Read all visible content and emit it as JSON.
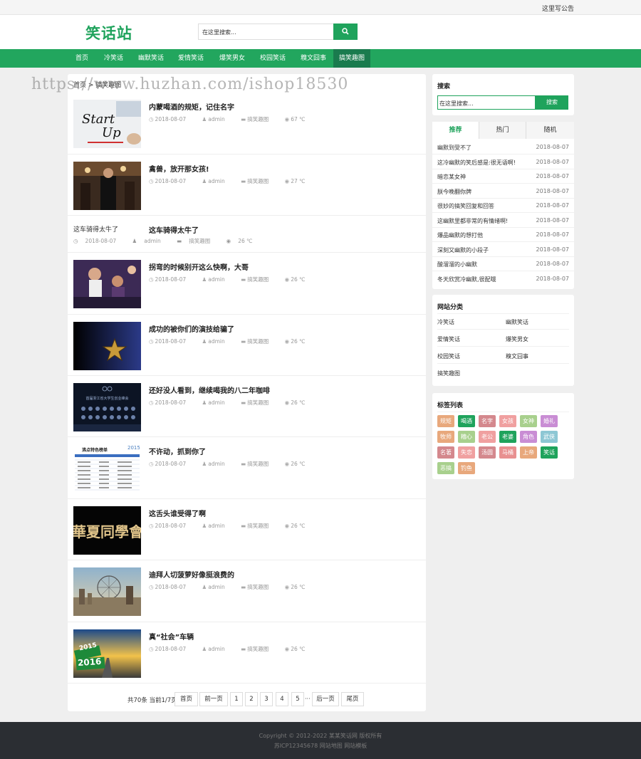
{
  "topbar": {
    "notice": "这里写公告"
  },
  "header": {
    "logo": "笑话站",
    "search_placeholder": "在这里搜索...",
    "search_icon": "search-icon"
  },
  "nav": [
    "首页",
    "冷笑话",
    "幽默笑话",
    "爱情笑话",
    "爆笑男女",
    "校园笑话",
    "糗文囧事",
    "搞笑趣图"
  ],
  "watermark": "https://www.huzhan.com/ishop18530",
  "breadcrumb": "首页 > 搞笑趣图",
  "articles": [
    {
      "title": "内蒙喝酒的规矩，记住名字",
      "date": "2018-08-07",
      "author": "admin",
      "category": "搞笑趣图",
      "views": "67 ℃",
      "thumb": "start-up"
    },
    {
      "title": "禽兽，放开那女孩!",
      "date": "2018-08-07",
      "author": "admin",
      "category": "搞笑趣图",
      "views": "27 ℃",
      "thumb": "man"
    },
    {
      "title": "这车骑得太牛了",
      "date": "2018-08-07",
      "author": "admin",
      "category": "搞笑趣图",
      "views": "26 ℃",
      "alt": "这车骑得太牛了"
    },
    {
      "title": "拐弯的时候别开这么快啊，大哥",
      "date": "2018-08-07",
      "author": "admin",
      "category": "搞笑趣图",
      "views": "26 ℃",
      "thumb": "crowd"
    },
    {
      "title": "成功的被你们的演技给骗了",
      "date": "2018-08-07",
      "author": "admin",
      "category": "搞笑趣图",
      "views": "26 ℃",
      "thumb": "star"
    },
    {
      "title": "还好没人看到，继续喝我的八二年咖啡",
      "date": "2018-08-07",
      "author": "admin",
      "category": "搞笑趣图",
      "views": "26 ℃",
      "thumb": "stage",
      "thumb_text": "首届浙江省大学生创业峰会"
    },
    {
      "title": "不许动，抓到你了",
      "date": "2018-08-07",
      "author": "admin",
      "category": "搞笑趣图",
      "views": "26 ℃",
      "thumb": "list",
      "thumb_text": "沸点特色榜单",
      "thumb_year": "2015"
    },
    {
      "title": "这舌头谁受得了啊",
      "date": "2018-08-07",
      "author": "admin",
      "category": "搞笑趣图",
      "views": "26 ℃",
      "thumb": "calligraphy",
      "thumb_text": "華夏同學會"
    },
    {
      "title": "迪拜人切菠萝好像挺浪费的",
      "date": "2018-08-07",
      "author": "admin",
      "category": "搞笑趣图",
      "views": "26 ℃",
      "thumb": "city"
    },
    {
      "title": "真“社会”车辆",
      "date": "2018-08-07",
      "author": "admin",
      "category": "搞笑趣图",
      "views": "26 ℃",
      "thumb": "road",
      "thumb_text": "2016",
      "thumb_text2": "2015"
    }
  ],
  "pagination": {
    "info": "共70条 当前1/7页",
    "first": "首页",
    "prev": "前一页",
    "pages": [
      "1",
      "2",
      "3",
      "4",
      "5"
    ],
    "ellipsis": "···",
    "next": "后一页",
    "last": "尾页"
  },
  "sidebar": {
    "search": {
      "title": "搜索",
      "placeholder": "在这里搜索...",
      "button": "搜索"
    },
    "tabs": [
      "推荐",
      "热门",
      "随机"
    ],
    "tab_items": [
      {
        "title": "幽默到受不了",
        "date": "2018-08-07"
      },
      {
        "title": "这冷幽默的笑后感是:很无语啊!",
        "date": "2018-08-07"
      },
      {
        "title": "暗恋某女神",
        "date": "2018-08-07"
      },
      {
        "title": "朕今晚翻你牌",
        "date": "2018-08-07"
      },
      {
        "title": "很妙的搞笑回复和回答",
        "date": "2018-08-07"
      },
      {
        "title": "这幽默里都非常的有情绪啊!",
        "date": "2018-08-07"
      },
      {
        "title": "爆品幽默的想打他",
        "date": "2018-08-07"
      },
      {
        "title": "深刻又幽默的小段子",
        "date": "2018-08-07"
      },
      {
        "title": "酸溜溜的小幽默",
        "date": "2018-08-07"
      },
      {
        "title": "冬天欣赏冷幽默,很配哦",
        "date": "2018-08-07"
      }
    ],
    "categories": {
      "title": "网站分类",
      "items": [
        "冷笑话",
        "幽默笑话",
        "爱情笑话",
        "爆笑男女",
        "校园笑话",
        "糗文囧事",
        "搞笑趣图"
      ]
    },
    "tags": {
      "title": "标签列表",
      "items": [
        {
          "label": "规矩",
          "color": "#e8a87c"
        },
        {
          "label": "喝酒",
          "color": "#1fa35c"
        },
        {
          "label": "名字",
          "color": "#d4888d"
        },
        {
          "label": "女孩",
          "color": "#f0a0a0"
        },
        {
          "label": "女神",
          "color": "#a8d08d"
        },
        {
          "label": "婚礼",
          "color": "#c98dd4"
        },
        {
          "label": "牧师",
          "color": "#e8a87c"
        },
        {
          "label": "糟心",
          "color": "#a8d08d"
        },
        {
          "label": "老公",
          "color": "#f0a0a0"
        },
        {
          "label": "老婆",
          "color": "#1fa35c"
        },
        {
          "label": "角色",
          "color": "#c98dd4"
        },
        {
          "label": "武侠",
          "color": "#8dc7d4"
        },
        {
          "label": "名著",
          "color": "#d4888d"
        },
        {
          "label": "失恋",
          "color": "#f0a0a0"
        },
        {
          "label": "汤圆",
          "color": "#d4888d"
        },
        {
          "label": "马桶",
          "color": "#e89090"
        },
        {
          "label": "上帝",
          "color": "#e8a87c"
        },
        {
          "label": "笑话",
          "color": "#1fa35c"
        },
        {
          "label": "恶搞",
          "color": "#a8d08d"
        },
        {
          "label": "钓鱼",
          "color": "#e8a87c"
        }
      ]
    }
  },
  "footer": {
    "copyright": "Copyright © 2012-2022 某某笑话网 版权所有",
    "icp": "苏ICP12345678 网站地图 网站模板"
  },
  "colors": {
    "accent": "#1fa35c",
    "nav_bg": "#22a65e",
    "nav_active": "#1a7b4e",
    "footer_bg": "#2b2e33"
  }
}
